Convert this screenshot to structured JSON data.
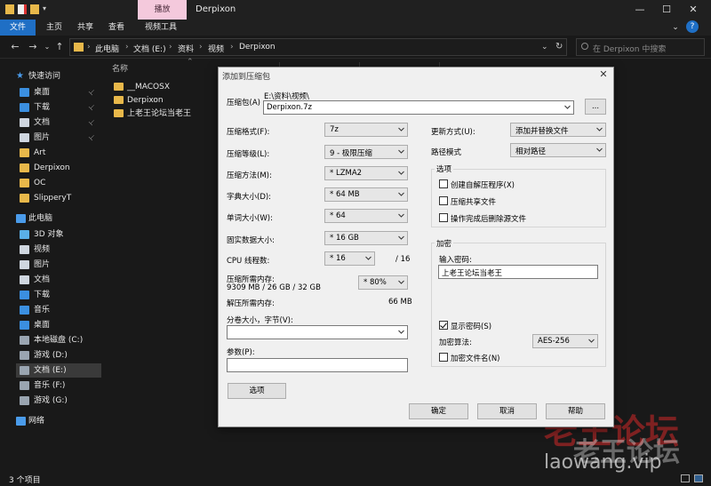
{
  "titlebar": {
    "context_tab": "播放",
    "title": "Derpixon",
    "minimize": "—",
    "maximize": "☐",
    "close": "✕"
  },
  "ribbon": {
    "tabs": [
      "文件",
      "主页",
      "共享",
      "查看",
      "视频工具"
    ]
  },
  "address": {
    "crumbs": [
      "此电脑",
      "文档 (E:)",
      "资料",
      "视频",
      "Derpixon"
    ],
    "search_placeholder": "在 Derpixon 中搜索"
  },
  "sidebar": {
    "items": [
      {
        "label": "快速访问",
        "top": true,
        "color": "#4a9bea"
      },
      {
        "label": "桌面",
        "color": "#3b8fe0",
        "pinned": true
      },
      {
        "label": "下载",
        "color": "#3b8fe0",
        "pinned": true
      },
      {
        "label": "文档",
        "color": "#cfd6df",
        "pinned": true
      },
      {
        "label": "图片",
        "color": "#cfd6df",
        "pinned": true
      },
      {
        "label": "Art",
        "color": "#e8b84a"
      },
      {
        "label": "Derpixon",
        "color": "#e8b84a"
      },
      {
        "label": "OC",
        "color": "#e8b84a"
      },
      {
        "label": "SlipperyT",
        "color": "#e8b84a"
      },
      {
        "label": "此电脑",
        "top": true,
        "color": "#4a9bea"
      },
      {
        "label": "3D 对象",
        "color": "#5ab0e8"
      },
      {
        "label": "视频",
        "color": "#cfd6df"
      },
      {
        "label": "图片",
        "color": "#cfd6df"
      },
      {
        "label": "文档",
        "color": "#cfd6df"
      },
      {
        "label": "下载",
        "color": "#3b8fe0"
      },
      {
        "label": "音乐",
        "color": "#3b8fe0"
      },
      {
        "label": "桌面",
        "color": "#3b8fe0"
      },
      {
        "label": "本地磁盘 (C:)",
        "color": "#9aa5b1"
      },
      {
        "label": "游戏 (D:)",
        "color": "#9aa5b1"
      },
      {
        "label": "文档 (E:)",
        "color": "#9aa5b1",
        "selected": true
      },
      {
        "label": "音乐 (F:)",
        "color": "#9aa5b1"
      },
      {
        "label": "游戏 (G:)",
        "color": "#9aa5b1"
      },
      {
        "label": "网络",
        "top": true,
        "color": "#4a9bea"
      }
    ],
    "pin_glyph": "📌"
  },
  "filelist": {
    "column_name": "名称",
    "files": [
      "__MACOSX",
      "Derpixon",
      "上老王论坛当老王"
    ]
  },
  "status": {
    "count": "3 个项目"
  },
  "dialog": {
    "title": "添加到压缩包",
    "archive_label": "压缩包(A)",
    "archive_path": "E:\\资料\\视频\\",
    "archive_name": "Derpixon.7z",
    "browse": "...",
    "format_label": "压缩格式(F):",
    "format_value": "7z",
    "level_label": "压缩等级(L):",
    "level_value": "9 - 极限压缩",
    "method_label": "压缩方法(M):",
    "method_value": "* LZMA2",
    "dict_label": "字典大小(D):",
    "dict_value": "* 64 MB",
    "word_label": "单词大小(W):",
    "word_value": "* 64",
    "solid_label": "固实数据大小:",
    "solid_value": "* 16 GB",
    "threads_label": "CPU 线程数:",
    "threads_value": "* 16",
    "threads_max": "/ 16",
    "mem_comp_label": "压缩所需内存:",
    "mem_comp_value": "9309 MB / 26 GB / 32 GB",
    "mem_percent": "* 80%",
    "mem_decomp_label": "解压所需内存:",
    "mem_decomp_value": "66 MB",
    "split_label": "分卷大小，字节(V):",
    "split_value": "",
    "params_label": "参数(P):",
    "params_value": "",
    "options_button": "选项",
    "update_label": "更新方式(U):",
    "update_value": "添加并替换文件",
    "path_label": "路径模式",
    "path_value": "相对路径",
    "options_group": "选项",
    "opt_sfx": "创建自解压程序(X)",
    "opt_shared": "压缩共享文件",
    "opt_delete": "操作完成后删除源文件",
    "enc_group": "加密",
    "pwd_label": "输入密码:",
    "pwd_value": "上老王论坛当老王",
    "show_pwd": "显示密码(S)",
    "enc_method_label": "加密算法:",
    "enc_method_value": "AES-256",
    "enc_names": "加密文件名(N)",
    "ok": "确定",
    "cancel": "取消",
    "help": "帮助"
  },
  "watermark": {
    "big": "老王论坛",
    "url": "laowang.vip"
  }
}
